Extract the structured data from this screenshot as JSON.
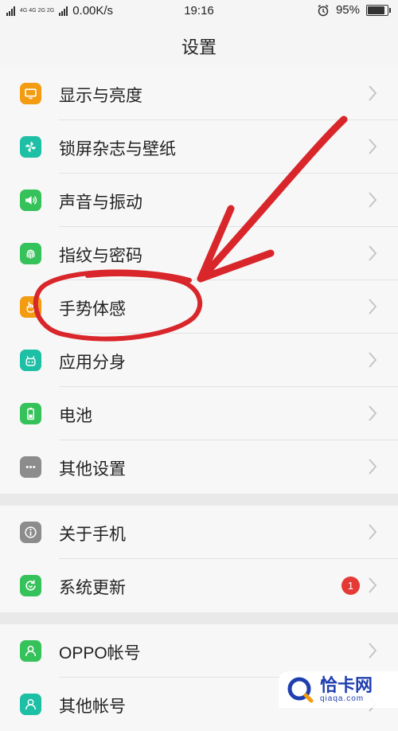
{
  "status_bar": {
    "network": "4G 4G 2G 2G",
    "speed": "0.00K/s",
    "time": "19:16",
    "battery": "95%",
    "battery_level": 0.95
  },
  "header": {
    "title": "设置"
  },
  "sections": [
    {
      "items": [
        {
          "label": "显示与亮度",
          "icon": "display-icon",
          "color": "#f39c12"
        },
        {
          "label": "锁屏杂志与壁纸",
          "icon": "pinwheel-icon",
          "color": "#1dbfa5"
        },
        {
          "label": "声音与振动",
          "icon": "speaker-icon",
          "color": "#36c25a"
        },
        {
          "label": "指纹与密码",
          "icon": "fingerprint-icon",
          "color": "#36c25a"
        },
        {
          "label": "手势体感",
          "icon": "hand-gesture-icon",
          "color": "#f39c12"
        },
        {
          "label": "应用分身",
          "icon": "app-clone-icon",
          "color": "#1dbfa5"
        },
        {
          "label": "电池",
          "icon": "battery-icon",
          "color": "#36c25a"
        },
        {
          "label": "其他设置",
          "icon": "more-dots-icon",
          "color": "#8c8c8c"
        }
      ]
    },
    {
      "items": [
        {
          "label": "关于手机",
          "icon": "info-icon",
          "color": "#8c8c8c"
        },
        {
          "label": "系统更新",
          "icon": "update-icon",
          "color": "#36c25a",
          "badge": "1"
        }
      ]
    },
    {
      "items": [
        {
          "label": "OPPO帐号",
          "icon": "user-icon",
          "color": "#36c25a"
        },
        {
          "label": "其他帐号",
          "icon": "users-icon",
          "color": "#1dbfa5"
        }
      ]
    }
  ],
  "watermark": {
    "title": "恰卡网",
    "subtitle": "qiaqa.com"
  },
  "annotation_color": "#d8262b"
}
